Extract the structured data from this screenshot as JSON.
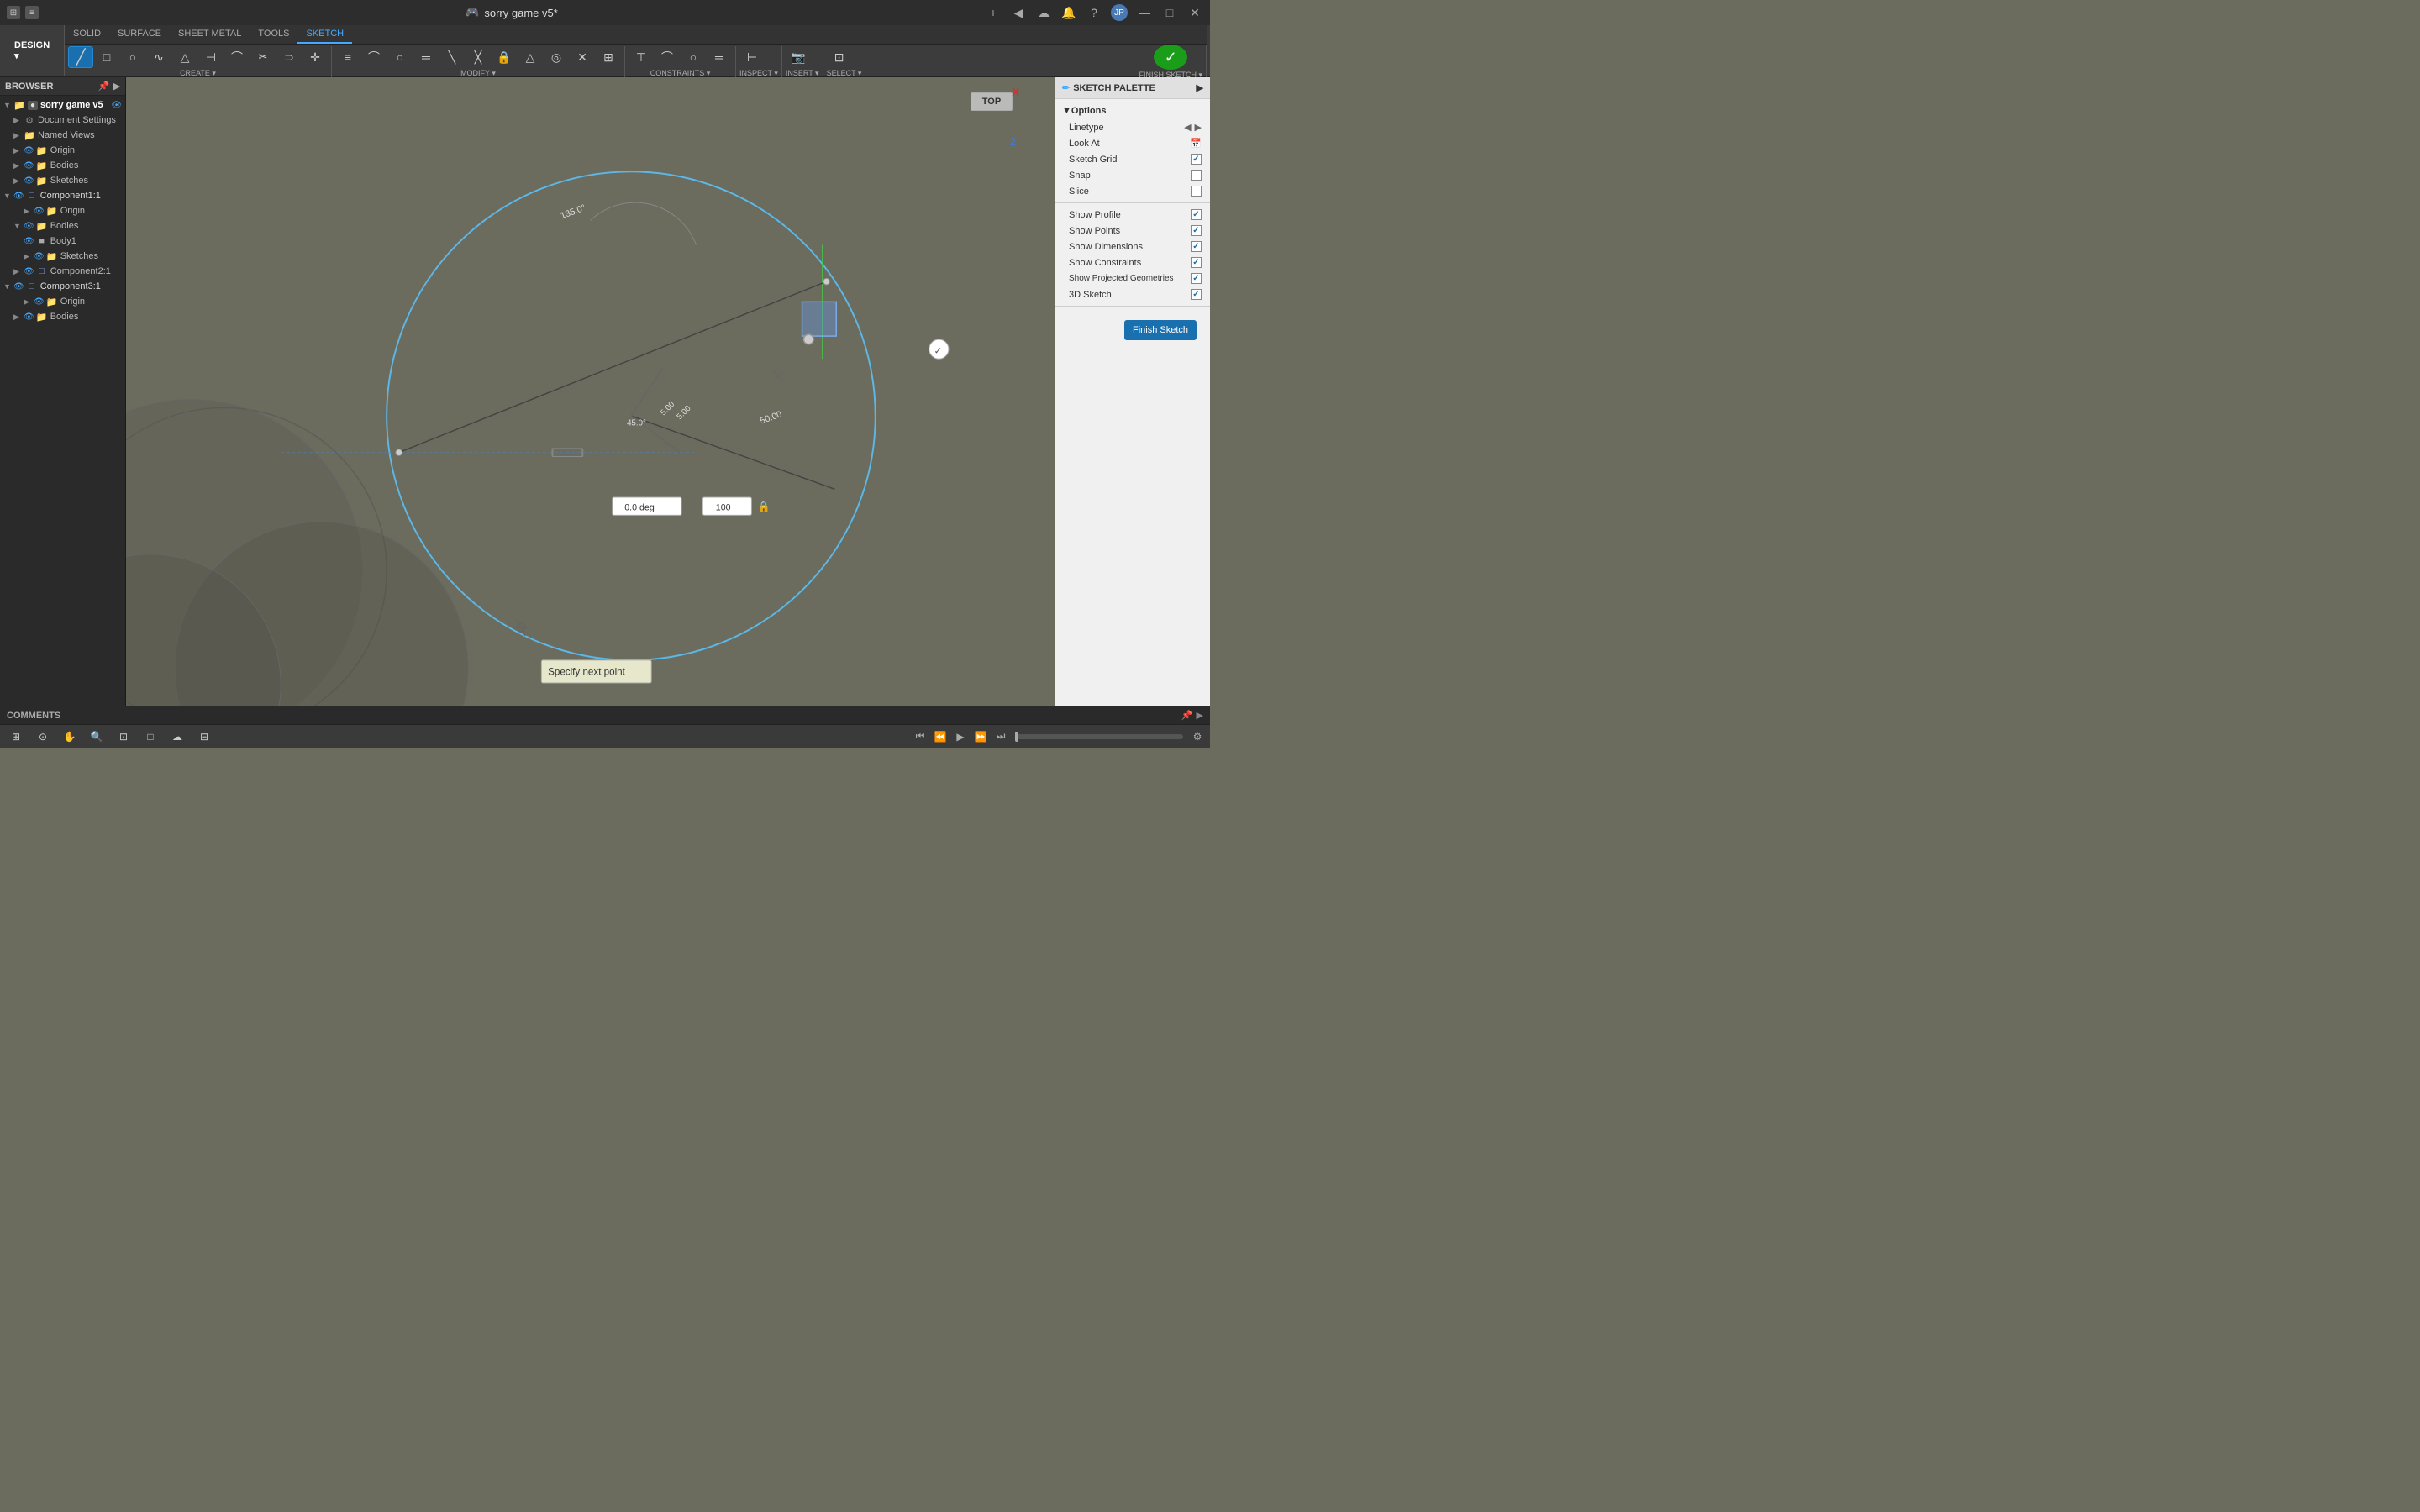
{
  "titlebar": {
    "app_icon": "●",
    "title": "sorry game v5*",
    "close": "✕",
    "minimize": "—",
    "maximize": "□",
    "plus_btn": "+",
    "nav_btns": [
      "◀",
      "▶",
      "☁",
      "🔔",
      "?"
    ]
  },
  "toolbar": {
    "tabs": [
      "SOLID",
      "SURFACE",
      "SHEET METAL",
      "TOOLS",
      "SKETCH"
    ],
    "active_tab": "SKETCH",
    "design_btn": "DESIGN ▾",
    "groups": [
      {
        "label": "CREATE",
        "tools": [
          "▶",
          "□",
          "◌",
          "∿",
          "△",
          "⊣",
          "⌒",
          "✂",
          "⊃",
          "✛"
        ]
      },
      {
        "label": "MODIFY",
        "tools": [
          "≡",
          "⌒",
          "○",
          "═",
          "╲",
          "╳",
          "🔒",
          "△",
          "◎",
          "✕",
          "⊞"
        ]
      },
      {
        "label": "CONSTRAINTS",
        "tools": [
          "⊤",
          "⌒",
          "○",
          "═"
        ]
      },
      {
        "label": "INSPECT",
        "tools": [
          "⊢"
        ]
      },
      {
        "label": "INSERT",
        "tools": [
          "📷"
        ]
      },
      {
        "label": "SELECT",
        "tools": [
          "⊡"
        ]
      },
      {
        "label": "FINISH SKETCH",
        "tools": [
          "✓"
        ]
      }
    ]
  },
  "browser": {
    "header": "BROWSER",
    "tree": [
      {
        "depth": 0,
        "label": "sorry game v5",
        "type": "root",
        "expanded": true,
        "hasEye": true
      },
      {
        "depth": 1,
        "label": "Document Settings",
        "type": "settings",
        "expanded": false,
        "hasEye": false
      },
      {
        "depth": 1,
        "label": "Named Views",
        "type": "folder",
        "expanded": false,
        "hasEye": false
      },
      {
        "depth": 1,
        "label": "Origin",
        "type": "folder",
        "expanded": false,
        "hasEye": true
      },
      {
        "depth": 1,
        "label": "Bodies",
        "type": "folder",
        "expanded": false,
        "hasEye": true
      },
      {
        "depth": 1,
        "label": "Sketches",
        "type": "folder",
        "expanded": false,
        "hasEye": true
      },
      {
        "depth": 0,
        "label": "Component1:1",
        "type": "component",
        "expanded": true,
        "hasEye": true
      },
      {
        "depth": 1,
        "label": "Origin",
        "type": "folder",
        "expanded": false,
        "hasEye": true
      },
      {
        "depth": 1,
        "label": "Bodies",
        "type": "folder",
        "expanded": true,
        "hasEye": true
      },
      {
        "depth": 2,
        "label": "Body1",
        "type": "body",
        "expanded": false,
        "hasEye": true
      },
      {
        "depth": 2,
        "label": "Sketches",
        "type": "folder",
        "expanded": false,
        "hasEye": true
      },
      {
        "depth": 1,
        "label": "Component2:1",
        "type": "component",
        "expanded": false,
        "hasEye": true
      },
      {
        "depth": 0,
        "label": "Component3:1",
        "type": "component",
        "expanded": true,
        "hasEye": true
      },
      {
        "depth": 1,
        "label": "Origin",
        "type": "folder",
        "expanded": false,
        "hasEye": true
      },
      {
        "depth": 1,
        "label": "Bodies",
        "type": "folder",
        "expanded": false,
        "hasEye": true
      }
    ]
  },
  "viewport": {
    "background": "#6b6b5e",
    "view_cube_label": "TOP",
    "axis_x": "X",
    "axis_z": "2",
    "dimension_135": "135.0°",
    "dimension_45": "45.0°",
    "dimension_50": "50.00",
    "dimension_5a": "5.00",
    "dimension_5b": "5.00",
    "angle_input": "0.0 deg",
    "length_input": "100",
    "tooltip": "Specify next point"
  },
  "sketch_palette": {
    "header": "SKETCH PALETTE",
    "section": "Options",
    "rows": [
      {
        "label": "Linetype",
        "type": "control",
        "value": ""
      },
      {
        "label": "Look At",
        "type": "control",
        "value": ""
      },
      {
        "label": "Sketch Grid",
        "type": "checkbox",
        "checked": true
      },
      {
        "label": "Snap",
        "type": "checkbox",
        "checked": false
      },
      {
        "label": "Slice",
        "type": "checkbox",
        "checked": false
      },
      {
        "label": "Show Profile",
        "type": "checkbox",
        "checked": true
      },
      {
        "label": "Show Points",
        "type": "checkbox",
        "checked": true
      },
      {
        "label": "Show Dimensions",
        "type": "checkbox",
        "checked": true
      },
      {
        "label": "Show Constraints",
        "type": "checkbox",
        "checked": true
      },
      {
        "label": "Show Projected Geometries",
        "type": "checkbox",
        "checked": true
      },
      {
        "label": "3D Sketch",
        "type": "checkbox",
        "checked": true
      }
    ],
    "finish_btn": "Finish Sketch"
  },
  "bottom": {
    "comments_label": "COMMENTS",
    "animation_controls": [
      "⏮",
      "⏪",
      "▶",
      "⏩",
      "⏭"
    ]
  },
  "colors": {
    "accent_blue": "#2d8cff",
    "sketch_line": "#5bb8e8",
    "bg": "#6b6b5e",
    "dark_line": "#333"
  }
}
